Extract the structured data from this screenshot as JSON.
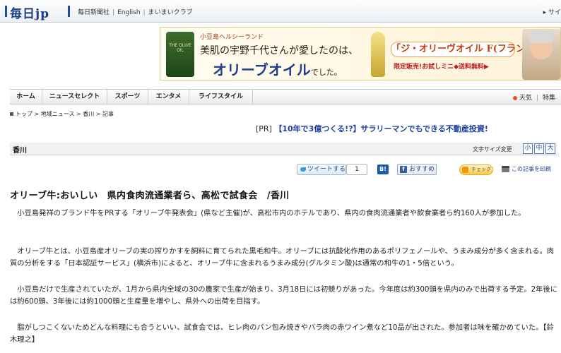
{
  "header": {
    "logo": "毎日jp",
    "links": [
      "毎日新聞社",
      "English",
      "まいまいクラブ"
    ],
    "right_link": "▸ サイ"
  },
  "banner": {
    "bottle_label": "THE OLIVE OIL",
    "small": "小豆島ヘルシーランド",
    "line1": "美肌の宇野千代さんが愛したのは、",
    "line2": "オリーブオイル",
    "line2_suffix": "でした。",
    "product": "「ジ・オリーヴオイル F(フランス)」",
    "sale": "限定販売!お試しミニ◆送料無料▶"
  },
  "nav": {
    "items": [
      "ホーム",
      "ニュースセレクト",
      "スポーツ",
      "エンタメ",
      "ライフスタイル"
    ],
    "weather": "天気",
    "special": "特集"
  },
  "breadcrumb": [
    "トップ",
    "地域ニュース",
    "香川",
    "記事"
  ],
  "pr": {
    "tag": "[PR]",
    "link": "【10年で3億つくる!?】サラリーマンでもできる不動産投資!"
  },
  "section": {
    "title": "香川",
    "font_size_label": "文字サイズ変更",
    "font_sizes": [
      "小",
      "中",
      "大"
    ]
  },
  "share": {
    "tweet": "ツイートする",
    "tweet_count": "1",
    "bj": "B!",
    "fb": "おすすめ",
    "fb_icon": "f",
    "check": "チェック",
    "print": "この記事を印刷"
  },
  "article": {
    "headline": "オリーブ牛:おいしい　県内食肉流通業者ら、高松で試食会　/香川",
    "paragraphs": [
      "小豆島発祥のブランド牛をPRする「オリーブ牛発表会」(県など主催)が、高松市内のホテルであり、県内の食肉流通業者や飲食業者ら約160人が参加した。",
      "オリーブ牛とは、小豆島産オリーブの実の搾りかすを飼料に育てられた黒毛和牛。オリーブには抗酸化作用のあるポリフェノールや、うまみ成分が多く含まれる。肉質の分析をする「日本認証サービス」(横浜市)によると、オリーブ牛に含まれるうまみ成分(グルタミン酸)は通常の和牛の1・5倍という。",
      "小豆島だけで生産されていたが、1月から県内全域の30の農家で生産が始まり、3月18日には初競りがあった。今年度は約300頭を県内のみで出荷する予定。2年後には約600頭、3年後には約1000頭と生産量を増やし、県外への出荷を目指す。",
      "脂がしつこくないためどんな料理にも合うといい、試食会では、ヒレ肉のパン包み焼きやバラ肉の赤ワイン煮など10品が出された。参加者は味を確かめていた。【鈴木理之】"
    ]
  }
}
